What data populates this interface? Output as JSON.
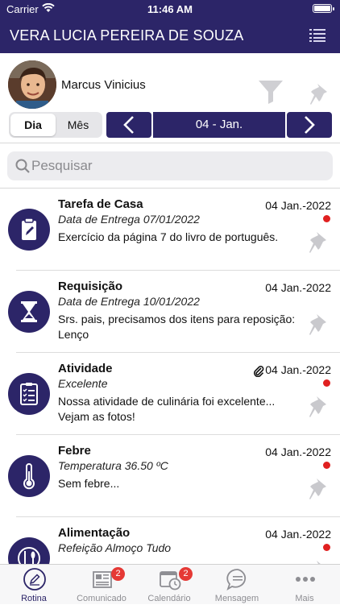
{
  "status_bar": {
    "carrier": "Carrier",
    "time": "11:46 AM"
  },
  "header": {
    "title": "VERA LUCIA PEREIRA DE SOUZA",
    "menu_icon": "list-menu-icon"
  },
  "profile": {
    "name": "Marcus Vinicius"
  },
  "segment": {
    "day": "Dia",
    "month": "Mês",
    "selected": "Dia"
  },
  "date_nav": {
    "current": "04 - Jan."
  },
  "search": {
    "placeholder": "Pesquisar"
  },
  "items": [
    {
      "title": "Tarefa de Casa",
      "subtitle": "Data de Entrega 07/01/2022",
      "desc": "Exercício da página 7 do livro de português.",
      "date": "04 Jan.-2022",
      "unread": true,
      "attachment": false,
      "icon": "clipboard-pen-icon"
    },
    {
      "title": "Requisição",
      "subtitle": "Data de Entrega 10/01/2022",
      "desc": "Srs. pais, precisamos dos itens para reposição: Lenço",
      "date": "04 Jan.-2022",
      "unread": false,
      "attachment": false,
      "icon": "hourglass-icon"
    },
    {
      "title": "Atividade",
      "subtitle": "Excelente",
      "desc": "Nossa atividade de culinária foi excelente... Vejam as fotos!",
      "date": "04 Jan.-2022",
      "unread": true,
      "attachment": true,
      "icon": "checklist-icon"
    },
    {
      "title": "Febre",
      "subtitle": "Temperatura 36.50 ºC",
      "desc": "Sem febre...",
      "date": "04 Jan.-2022",
      "unread": true,
      "attachment": false,
      "icon": "thermometer-icon"
    },
    {
      "title": "Alimentação",
      "subtitle": "Refeição Almoço Tudo",
      "desc": "",
      "date": "04 Jan.-2022",
      "unread": true,
      "attachment": false,
      "icon": "cutlery-icon"
    }
  ],
  "tabs": [
    {
      "label": "Rotina",
      "active": true,
      "badge": ""
    },
    {
      "label": "Comunicado",
      "active": false,
      "badge": "2"
    },
    {
      "label": "Calendário",
      "active": false,
      "badge": "2"
    },
    {
      "label": "Mensagem",
      "active": false,
      "badge": ""
    },
    {
      "label": "Mais",
      "active": false,
      "badge": ""
    }
  ],
  "colors": {
    "primary": "#2c2568",
    "unread_dot": "#e02020",
    "badge": "#e53935"
  }
}
